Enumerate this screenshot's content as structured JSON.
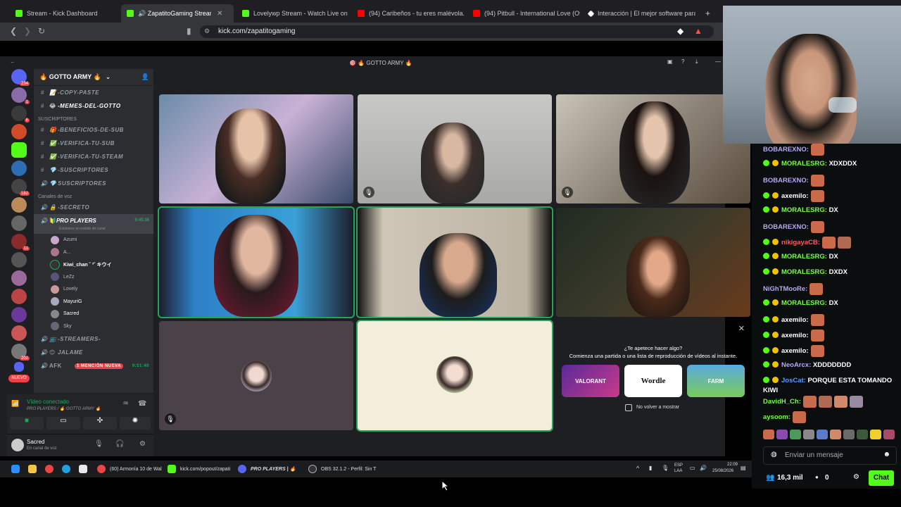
{
  "browser": {
    "tabs": [
      {
        "label": "Stream - Kick Dashboard",
        "color": "#53fc18",
        "active": false
      },
      {
        "label": "🔊 ZapatitoGaming Stream - Wa",
        "color": "#53fc18",
        "active": true
      },
      {
        "label": "Lovelywp Stream - Watch Live on Kic",
        "color": "#53fc18",
        "active": false
      },
      {
        "label": "(94) Caribeños - tu eres malévola. - Y",
        "color": "#ff0000",
        "active": false
      },
      {
        "label": "(94) Pitbull - International Love (Offic",
        "color": "#ff0000",
        "active": false
      },
      {
        "label": "Interacción | El mejor software para p",
        "color": "#ffffff",
        "active": false
      }
    ],
    "tab_close": "✕",
    "new_tab": "+",
    "url": "kick.com/zapatitogaming"
  },
  "discord": {
    "window_title": "🎯 🔥 GOTTO ARMY 🔥",
    "server_name": "🔥 GOTTO ARMY 🔥",
    "text_channels": [
      "-COPY-PASTE",
      "-MEMES-DEL-GOTTO"
    ],
    "category_subs": "SUSCRIPTORES",
    "sub_channels": [
      "-BENEFICIOS-DE-SUB",
      "-VERIFICA-TU-SUB",
      "-VERIFICA-TU-STEAM",
      "-SUSCRIPTORES",
      "SUSCRIPTORES"
    ],
    "category_voice": "Canales de voz",
    "voice_channels_top": [
      "-SECRETO"
    ],
    "active_voice": {
      "name": "PRO PLAYERS",
      "time": "6:45:38",
      "status": "Establece un estado de canal"
    },
    "voice_users": [
      "Azumi",
      "A...",
      "Kiwi_chan ˘ ³˘ キウイ",
      "LeZz",
      "Lovely",
      "MayuriG",
      "Sacred",
      "Sky"
    ],
    "voice_channels_bottom": [
      "-STREAMERS-",
      "JALAME"
    ],
    "afk": {
      "name": "AFK",
      "mention": "1 MENCIÓN NUEVA",
      "time": "9:51:40"
    },
    "new_badge": "NUEVO",
    "guild_badges": [
      "234",
      "1",
      "6",
      "182",
      "11",
      "202"
    ],
    "voice_panel": {
      "status": "Vídeo conectado",
      "channel": "PRO PLAYERS / 🔥 GOTTO ARMY 🔥"
    },
    "user_panel": {
      "name": "Sacred",
      "status": "En canal de voz"
    },
    "activity": {
      "title": "¿Te apetece hacer algo?",
      "subtitle": "Comienza una partida o una lista de reproducción de vídeos al instante.",
      "games": [
        {
          "name": "VALORANT",
          "color": "#6b2fb3"
        },
        {
          "name": "Wordle",
          "color": "#ffffff"
        },
        {
          "name": "FARM",
          "color": "#4fa3d9"
        }
      ],
      "checkbox_label": "No volver a mostrar",
      "close": "✕"
    }
  },
  "chat": {
    "messages": [
      {
        "user": "BOBAREXNO:",
        "color": "#b9a7f5",
        "text": "",
        "emotes": 1,
        "badges": false
      },
      {
        "user": "MORALESRG:",
        "color": "#75fd46",
        "text": "XDXDDX",
        "emotes": 0,
        "badges": true
      },
      {
        "user": "BOBAREXNO:",
        "color": "#b9a7f5",
        "text": "",
        "emotes": 1,
        "badges": false
      },
      {
        "user": "axemilo:",
        "color": "#ffffff",
        "text": "",
        "emotes": 1,
        "badges": true
      },
      {
        "user": "MORALESRG:",
        "color": "#75fd46",
        "text": "DX",
        "emotes": 0,
        "badges": true
      },
      {
        "user": "BOBAREXNO:",
        "color": "#b9a7f5",
        "text": "",
        "emotes": 1,
        "badges": false
      },
      {
        "user": "nikigayaCB:",
        "color": "#ff5b5b",
        "text": "",
        "emotes": 2,
        "badges": true
      },
      {
        "user": "MORALESRG:",
        "color": "#75fd46",
        "text": "DX",
        "emotes": 0,
        "badges": true
      },
      {
        "user": "MORALESRG:",
        "color": "#75fd46",
        "text": "DXDX",
        "emotes": 0,
        "badges": true
      },
      {
        "user": "NiGhTMooRe:",
        "color": "#b9a7f5",
        "text": "",
        "emotes": 1,
        "badges": false
      },
      {
        "user": "MORALESRG:",
        "color": "#75fd46",
        "text": "DX",
        "emotes": 0,
        "badges": true
      },
      {
        "user": "axemilo:",
        "color": "#ffffff",
        "text": "",
        "emotes": 1,
        "badges": true
      },
      {
        "user": "axemilo:",
        "color": "#ffffff",
        "text": "",
        "emotes": 1,
        "badges": true
      },
      {
        "user": "axemilo:",
        "color": "#ffffff",
        "text": "",
        "emotes": 1,
        "badges": true
      },
      {
        "user": "NeoArcx:",
        "color": "#b9a7f5",
        "text": "XDDDDDDD",
        "emotes": 0,
        "badges": true
      },
      {
        "user": "JosCat:",
        "color": "#5b9bff",
        "text": "PORQUE ESTA TOMANDO KIWI",
        "emotes": 0,
        "badges": true
      },
      {
        "user": "DavidH_Ch:",
        "color": "#75fd46",
        "text": "",
        "emotes": 4,
        "badges": false
      },
      {
        "user": "aysoom:",
        "color": "#75fd46",
        "text": "",
        "emotes": 1,
        "badges": false
      }
    ],
    "input_placeholder": "Enviar un mensaje",
    "viewers": "16,3 mil",
    "points": "0",
    "chat_button": "Chat"
  },
  "taskbar": {
    "items": [
      "(60) Armonía 10 de Wal",
      "kick.com/popout/zapati",
      "PRO PLAYERS | 🔥",
      "OBS 32.1.2 - Perfil: Sin T"
    ],
    "lang": "ESP\nLAA",
    "time": "22:09",
    "date": "25/08/2026"
  }
}
